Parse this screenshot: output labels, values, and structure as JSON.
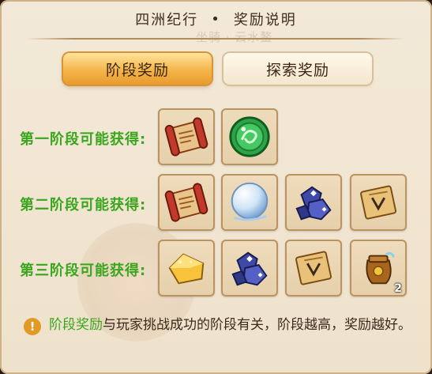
{
  "header": {
    "left": "四洲纪行",
    "sep": "•",
    "right": "奖励说明"
  },
  "background": {
    "ghost_title": "坐骑 · 云水鳌"
  },
  "tabs": [
    {
      "label": "阶段奖励",
      "active": true
    },
    {
      "label": "探索奖励",
      "active": false
    }
  ],
  "stages": [
    {
      "label": "第一阶段可能获得:",
      "items": [
        "scroll-icon",
        "jade-disc-icon"
      ]
    },
    {
      "label": "第二阶段可能获得:",
      "items": [
        "scroll-icon",
        "pearl-orb-icon",
        "crystal-ore-icon",
        "map-scroll-icon"
      ]
    },
    {
      "label": "第三阶段可能获得:",
      "items": [
        "gold-ingot-icon",
        "crystal-ore-icon",
        "map-scroll-icon",
        "treasure-pot-icon"
      ]
    }
  ],
  "item_counts": {
    "treasure_pot": "2"
  },
  "info": {
    "highlight": "阶段奖励",
    "text": "与玩家挑战成功的阶段有关，阶段越高，奖励越好。",
    "icon": "!"
  },
  "colors": {
    "accent_green": "#3aa61d",
    "tab_active": "#f5b54a",
    "info_icon": "#e09a25"
  }
}
